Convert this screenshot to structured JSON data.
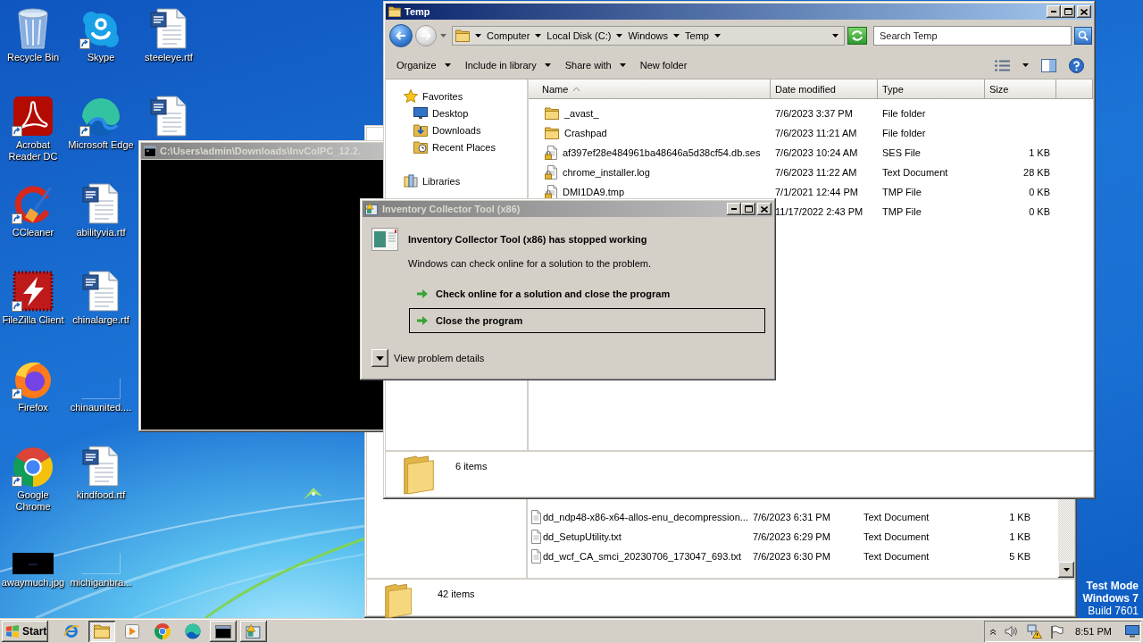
{
  "desktop": {
    "icons": [
      {
        "label": "Recycle Bin",
        "kind": "recycle-bin",
        "shortcut": false
      },
      {
        "label": "Acrobat Reader DC",
        "kind": "acrobat",
        "shortcut": true
      },
      {
        "label": "CCleaner",
        "kind": "ccleaner",
        "shortcut": true
      },
      {
        "label": "FileZilla Client",
        "kind": "filezilla",
        "shortcut": true
      },
      {
        "label": "Firefox",
        "kind": "firefox",
        "shortcut": true
      },
      {
        "label": "Google Chrome",
        "kind": "chrome",
        "shortcut": true
      },
      {
        "label": "awaymuch.jpg",
        "kind": "image",
        "shortcut": false
      },
      {
        "label": "Skype",
        "kind": "skype",
        "shortcut": true
      },
      {
        "label": "Microsoft Edge",
        "kind": "edge",
        "shortcut": true
      },
      {
        "label": "abilityvia.rtf",
        "kind": "document",
        "shortcut": false
      },
      {
        "label": "chinalarge.rtf",
        "kind": "document",
        "shortcut": false
      },
      {
        "label": "chinaunited....",
        "kind": "blank",
        "shortcut": false
      },
      {
        "label": "kindfood.rtf",
        "kind": "document",
        "shortcut": false
      },
      {
        "label": "michiganbra...",
        "kind": "blank",
        "shortcut": false
      },
      {
        "label": "steeleye.rtf",
        "kind": "document",
        "shortcut": false
      },
      {
        "kind": "document",
        "shortcut": false
      }
    ]
  },
  "background_explorer": {
    "files": [
      {
        "name": "dd_ndp48-x86-x64-allos-enu_decompression...",
        "kind": "file",
        "locked": false,
        "date": "7/6/2023 6:31 PM",
        "type": "Text Document",
        "size": "1 KB"
      },
      {
        "name": "dd_SetupUtility.txt",
        "kind": "file",
        "locked": false,
        "date": "7/6/2023 6:29 PM",
        "type": "Text Document",
        "size": "1 KB"
      },
      {
        "name": "dd_wcf_CA_smci_20230706_173047_693.txt",
        "kind": "file",
        "locked": false,
        "date": "7/6/2023 6:30 PM",
        "type": "Text Document",
        "size": "5 KB"
      }
    ],
    "status": "42 items"
  },
  "console_window": {
    "title": "C:\\Users\\admin\\Downloads\\InvColPC_12.2.",
    "active": false
  },
  "explorer": {
    "title": "Temp",
    "active": true,
    "back": {
      "disabled": false
    },
    "forward": {
      "disabled": true
    },
    "breadcrumb": [
      "Computer",
      "Local Disk (C:)",
      "Windows",
      "Temp"
    ],
    "search": {
      "placeholder": "Search Temp"
    },
    "toolbar": [
      {
        "label": "Organize",
        "dropdown": true
      },
      {
        "label": "Include in library",
        "dropdown": true
      },
      {
        "label": "Share with",
        "dropdown": true
      },
      {
        "label": "New folder",
        "dropdown": false
      }
    ],
    "navigation": [
      {
        "label": "Favorites",
        "kind": "favorites",
        "children": [
          {
            "label": "Desktop",
            "kind": "desktop"
          },
          {
            "label": "Downloads",
            "kind": "downloads"
          },
          {
            "label": "Recent Places",
            "kind": "recent"
          }
        ]
      },
      {
        "label": "Libraries",
        "kind": "libraries"
      }
    ],
    "columns": [
      {
        "label": "Name",
        "sorted": true
      },
      {
        "label": "Date modified",
        "sorted": false
      },
      {
        "label": "Type",
        "sorted": false
      },
      {
        "label": "Size",
        "sorted": false
      }
    ],
    "files": [
      {
        "name": "_avast_",
        "kind": "folder",
        "date": "7/6/2023 3:37 PM",
        "type": "File folder"
      },
      {
        "name": "Crashpad",
        "kind": "folder",
        "date": "7/6/2023 11:21 AM",
        "type": "File folder"
      },
      {
        "name": "af397ef28e484961ba48646a5d38cf54.db.ses",
        "kind": "file",
        "locked": true,
        "date": "7/6/2023 10:24 AM",
        "type": "SES File",
        "size": "1 KB"
      },
      {
        "name": "chrome_installer.log",
        "kind": "file",
        "locked": true,
        "date": "7/6/2023 11:22 AM",
        "type": "Text Document",
        "size": "28 KB"
      },
      {
        "name": "DMI1DA9.tmp",
        "kind": "file",
        "locked": true,
        "date": "7/1/2021 12:44 PM",
        "type": "TMP File",
        "size": "0 KB"
      },
      {
        "date": "11/17/2022 2:43 PM",
        "type": "TMP File",
        "size": "0 KB"
      }
    ],
    "status": "6 items"
  },
  "error_dialog": {
    "title": "Inventory Collector Tool (x86)",
    "active": false,
    "heading": "Inventory Collector Tool (x86) has stopped working",
    "message": "Windows can check online for a solution to the problem.",
    "options": [
      {
        "label": "Check online for a solution and close the program",
        "selected": false
      },
      {
        "label": "Close the program",
        "selected": true
      }
    ],
    "details_toggle": {
      "label": "View problem details",
      "expanded": false
    }
  },
  "test_mode_notice": {
    "mode": "Test Mode",
    "os": "Windows 7",
    "build": "Build 7601"
  },
  "taskbar": {
    "start": "Start",
    "apps": [
      {
        "kind": "ie",
        "selected": false,
        "open": false
      },
      {
        "kind": "explorer",
        "selected": true,
        "open": true
      },
      {
        "kind": "media-player",
        "selected": false,
        "open": false
      },
      {
        "kind": "chrome",
        "selected": false,
        "open": false
      },
      {
        "kind": "edge",
        "selected": false,
        "open": false
      },
      {
        "kind": "console",
        "selected": false,
        "open": true
      },
      {
        "kind": "error-dialog",
        "selected": false,
        "open": true
      }
    ],
    "clock": "8:51 PM"
  }
}
